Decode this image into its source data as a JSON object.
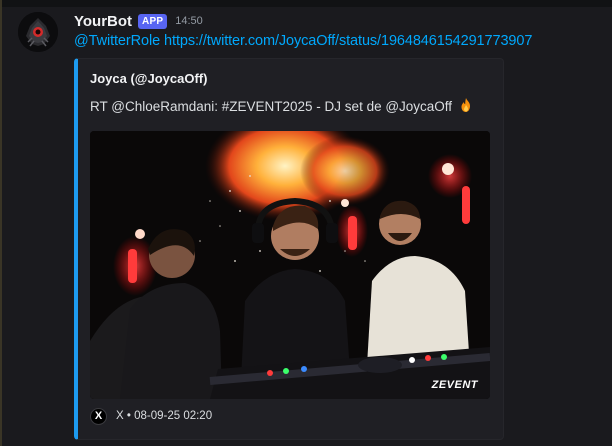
{
  "message": {
    "author": "YourBot",
    "tag": "APP",
    "timestamp": "14:50",
    "mention": "@TwitterRole",
    "link": "https://twitter.com/JoycaOff/status/1964846154291773907"
  },
  "embed": {
    "accent_color": "#1d9bf0",
    "author": "Joyca (@JoycaOff)",
    "description": "RT @ChloeRamdani: #ZEVENT2025 - DJ set de @JoycaOff",
    "description_emoji": "fire-icon",
    "image_watermark": "ZEVENT",
    "footer": {
      "icon": "x-logo-icon",
      "icon_text": "X",
      "text": "X • 08-09-25 02:20"
    }
  },
  "colors": {
    "background": "#1a1a1e",
    "app_tag": "#5865f2",
    "link": "#00a8fc"
  }
}
